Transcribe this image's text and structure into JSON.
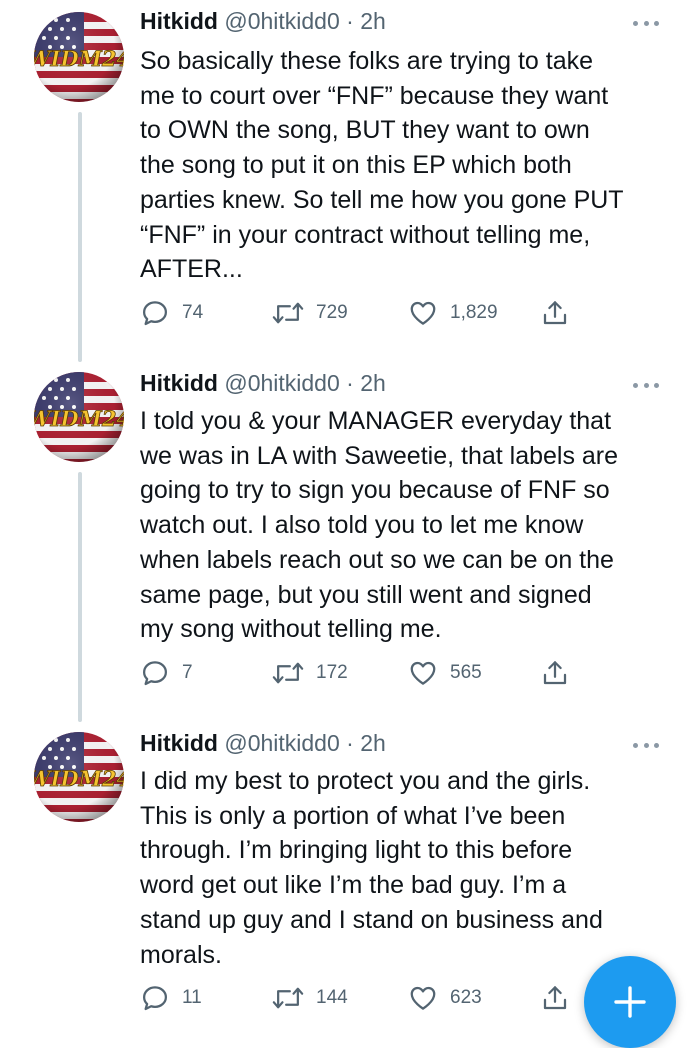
{
  "thread": {
    "tweets": [
      {
        "author_name": "Hitkidd",
        "author_handle": "@0hitkidd0",
        "separator": "·",
        "time": "2h",
        "avatar_text": "WIDM24",
        "text": "So basically these folks are trying to take\nme to court over “FNF” because  they want\nto OWN the song, BUT they want to own\nthe song to put it on this EP which both\nparties knew. So tell me how you gone PUT\n“FNF” in your contract without telling me,\nAFTER...",
        "replies": "74",
        "retweets": "729",
        "likes": "1,829"
      },
      {
        "author_name": "Hitkidd",
        "author_handle": "@0hitkidd0",
        "separator": "·",
        "time": "2h",
        "avatar_text": "WIDM24",
        "text": "I told you & your MANAGER everyday that\nwe was in LA with Saweetie, that labels are\ngoing to try to sign you because of FNF so\nwatch out. I also told you to let me know\nwhen labels reach out so we can be on the\nsame page, but you still went and signed\nmy song without telling me.",
        "replies": "7",
        "retweets": "172",
        "likes": "565"
      },
      {
        "author_name": "Hitkidd",
        "author_handle": "@0hitkidd0",
        "separator": "·",
        "time": "2h",
        "avatar_text": "WIDM24",
        "text": "I did my best to protect you and the girls.\nThis is only a portion of what I’ve been\nthrough. I’m bringing light to this before\nword get out like I’m the bad guy. I’m a\nstand up guy and I stand on business and\nmorals.",
        "replies": "11",
        "retweets": "144",
        "likes": "623"
      }
    ]
  },
  "icons": {
    "reply": "speech-bubble",
    "retweet": "retweet-arrows",
    "like": "heart-outline",
    "share": "share-up-arrow",
    "more": "three-dots",
    "compose": "plus"
  },
  "colors": {
    "text": "#0f1419",
    "secondary": "#536471",
    "thread_line": "#cfd9de",
    "accent": "#1d9bf0",
    "avatar_text": "#f4c430"
  }
}
